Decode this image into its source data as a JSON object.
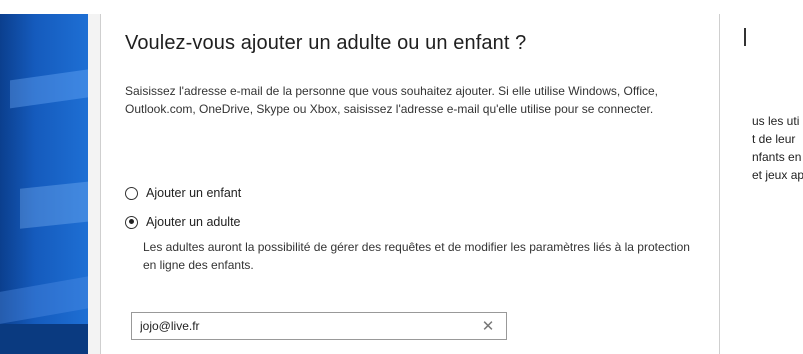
{
  "dialog": {
    "title": "Voulez-vous ajouter un adulte ou un enfant ?",
    "description": "Saisissez l'adresse e-mail de la personne que vous souhaitez ajouter. Si elle utilise Windows, Office, Outlook.com, OneDrive, Skype ou Xbox, saisissez l'adresse e-mail qu'elle utilise pour se connecter.",
    "options": [
      {
        "label": "Ajouter un enfant",
        "selected": false
      },
      {
        "label": "Ajouter un adulte",
        "selected": true
      }
    ],
    "adult_note": "Les adultes auront la possibilité de gérer des requêtes et de modifier les paramètres liés à la protection en ligne des enfants.",
    "email": {
      "value": "jojo@live.fr",
      "clear_icon": "close-icon"
    }
  },
  "background_window": {
    "lines": [
      "us les uti",
      "t de leur",
      "nfants en",
      "et jeux ap"
    ]
  },
  "colors": {
    "desktop_blue": "#155bbd",
    "dialog_bg": "#ffffff",
    "text": "#1f1f1f"
  }
}
